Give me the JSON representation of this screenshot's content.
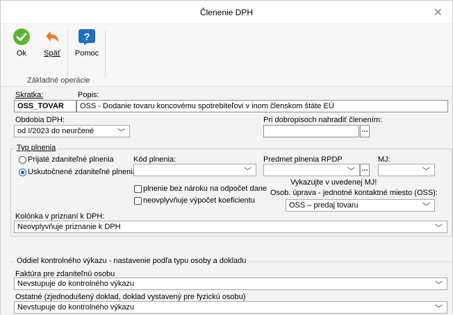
{
  "window": {
    "title": "Členenie DPH"
  },
  "ribbon": {
    "ok_label": "Ok",
    "back_label": "Späť",
    "help_label": "Pomoc",
    "group_label": "Základné operácie"
  },
  "form": {
    "skratka_label": "Skratka:",
    "skratka_value": "OSS_TOVAR",
    "popis_label": "Popis:",
    "popis_value": "OSS - Dodanie tovaru koncovému spotrebiteľovi v inom členskom štáte EÚ",
    "obdobia_label": "Obdobia DPH:",
    "obdobia_value": "od I/2023 do neurčené",
    "dobropis_label": "Pri dobropisoch nahradiť členením:",
    "dobropis_value": "",
    "typ_plnenia_label": "Typ plnenia",
    "radio_prijate": "Prijaté zdaniteľné plnenia",
    "radio_uskutocnene": "Uskutočnené zdaniteľné plnenia",
    "radio_selected": "uskutocnene",
    "kod_plnenia_label": "Kód plnenia:",
    "kod_plnenia_value": "",
    "predmet_label": "Predmet plnenia RPDP",
    "predmet_value": "",
    "mj_label": "MJ:",
    "mj_value": "",
    "vykazujte_text": "Vykazujte v uvedenej MJ!",
    "chk_bez_naroku": "plnenie bez nároku na odpočet dane",
    "chk_neovplyvnuje": "neovplyvňuje výpočet koeficientu",
    "osob_uprava_label": "Osob. úprava - jednotné kontaktné miesto (OSS):",
    "osob_uprava_value": "OSS – predaj tovaru",
    "kolonka_label": "Kolónka v priznaní k DPH:",
    "kolonka_value": "Neovplyvňuje priznanie k DPH"
  },
  "kontrolny": {
    "section_title": "Oddiel kontrolného výkazu - nastavenie podľa typu osoby a dokladu",
    "faktura_label": "Faktúra pre zdaniteľnú osobu",
    "faktura_value": "Nevstupuje do kontrolného výkazu",
    "ostatne_label": "Ostatné (zjednodušený doklad, doklad vystavený pre fyzickú osobu)",
    "ostatne_value": "Nevstupuje do kontrolného výkazu"
  },
  "colors": {
    "ok_green": "#5cb531",
    "back_orange": "#e8792e",
    "help_blue": "#1f6fc4",
    "radio_blue": "#1c5fb5"
  }
}
